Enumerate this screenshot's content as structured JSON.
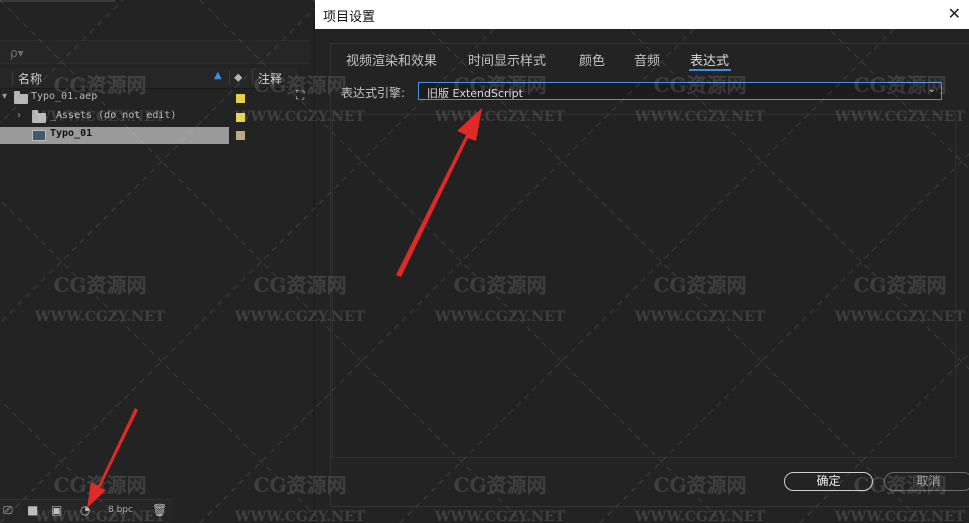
{
  "dialog": {
    "title": "项目设置",
    "close_icon": "close-icon",
    "tabs": [
      "视频渲染和效果",
      "时间显示样式",
      "颜色",
      "音频",
      "表达式"
    ],
    "active_tab": "表达式",
    "engine_label": "表达式引擎:",
    "engine_value": "旧版 ExtendScript",
    "ok_label": "确定",
    "cancel_label": "取消"
  },
  "project_panel": {
    "search_placeholder": "ρ▾",
    "col_name": "名称",
    "col_notes": "注释",
    "items": [
      {
        "label": "Typo_01.aep",
        "icon": "folder-icon",
        "color": "#e5d24a"
      },
      {
        "label": "_Assets (do not edit)",
        "icon": "folder-icon",
        "color": "#e5d24a"
      },
      {
        "label": "Typo_01",
        "icon": "composition-icon",
        "color": "#b9a983"
      }
    ],
    "bit_depth": "8 bpc"
  },
  "watermark": {
    "logo": "CG资源网",
    "url": "WWW.CGZY.NET"
  },
  "colors": {
    "accent": "#3a8ee6",
    "annotation_arrow": "#e0302c"
  }
}
